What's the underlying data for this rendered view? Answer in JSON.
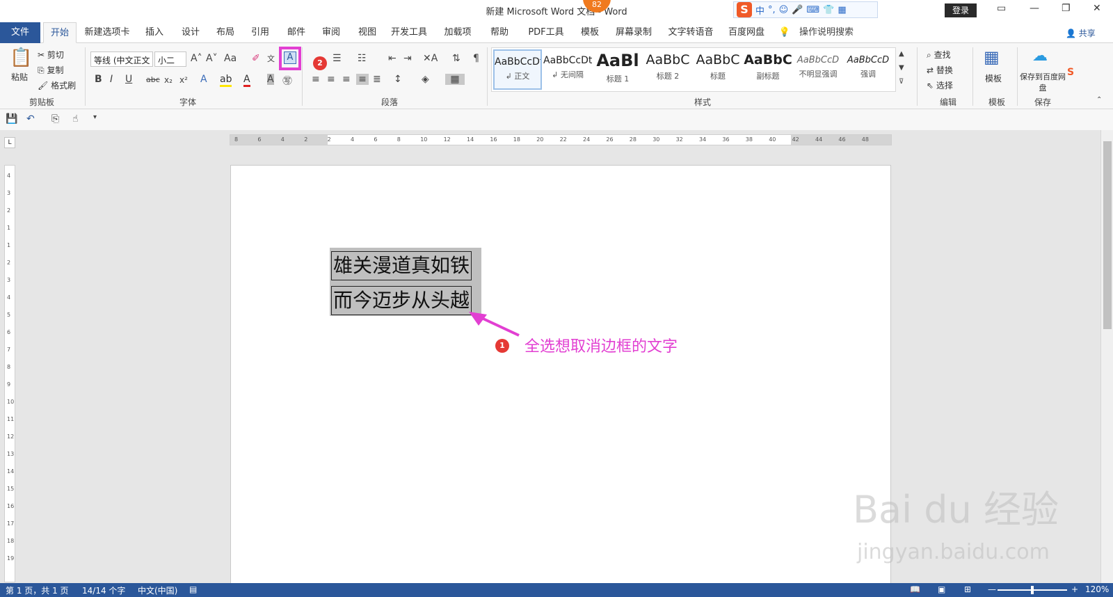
{
  "window": {
    "title": "新建 Microsoft Word 文档 - Word",
    "badge": "82",
    "login": "登录",
    "ime": {
      "logo": "S",
      "items": [
        "中",
        "°,",
        "☺",
        "🎤",
        "⌨",
        "👕",
        "▦"
      ]
    },
    "controls": {
      "ribbon_display": "▭",
      "minimize": "—",
      "restore": "❐",
      "close": "✕"
    }
  },
  "tabs": {
    "file": "文件",
    "items": [
      "开始",
      "新建选项卡",
      "插入",
      "设计",
      "布局",
      "引用",
      "邮件",
      "审阅",
      "视图",
      "开发工具",
      "加载项",
      "帮助",
      "PDF工具",
      "模板",
      "屏幕录制",
      "文字转语音",
      "百度网盘"
    ],
    "active": "开始",
    "search_hint": "操作说明搜索",
    "share": "共享"
  },
  "ribbon": {
    "clipboard": {
      "paste": "粘贴",
      "cut": "剪切",
      "copy": "复制",
      "format_painter": "格式刷",
      "label": "剪贴板"
    },
    "font": {
      "font_name": "等线 (中文正文",
      "font_size": "小二",
      "label": "字体",
      "bold": "B",
      "italic": "I",
      "underline": "U",
      "strike": "abc",
      "sub": "x₂",
      "sup": "x²",
      "grow": "A˄",
      "shrink": "A˅",
      "case": "Aa",
      "char_border": "A"
    },
    "paragraph": {
      "label": "段落"
    },
    "styles": {
      "label": "样式",
      "items": [
        {
          "preview": "AaBbCcDt",
          "name": "↲ 正文"
        },
        {
          "preview": "AaBbCcDt",
          "name": "↲ 无间隔"
        },
        {
          "preview": "AaBl",
          "name": "标题 1"
        },
        {
          "preview": "AaBbC",
          "name": "标题 2"
        },
        {
          "preview": "AaBbC",
          "name": "标题"
        },
        {
          "preview": "AaBbC",
          "name": "副标题"
        },
        {
          "preview": "AaBbCcD",
          "name": "不明显强调"
        },
        {
          "preview": "AaBbCcD",
          "name": "强调"
        }
      ]
    },
    "editing": {
      "find": "查找",
      "replace": "替换",
      "select": "选择",
      "label": "编辑"
    },
    "template": {
      "button": "模板",
      "label": "模板"
    },
    "save": {
      "button": "保存到百度网盘",
      "label": "保存"
    }
  },
  "ruler": {
    "h_ticks": [
      "8",
      "6",
      "4",
      "2",
      "2",
      "4",
      "6",
      "8",
      "10",
      "12",
      "14",
      "16",
      "18",
      "20",
      "22",
      "24",
      "26",
      "28",
      "30",
      "32",
      "34",
      "36",
      "38",
      "40",
      "42",
      "44",
      "46",
      "48"
    ],
    "v_ticks": [
      "4",
      "3",
      "2",
      "1",
      "1",
      "2",
      "3",
      "4",
      "5",
      "6",
      "7",
      "8",
      "9",
      "10",
      "11",
      "12",
      "13",
      "14",
      "15",
      "16",
      "17",
      "18",
      "19"
    ]
  },
  "document": {
    "lines": [
      "雄关漫道真如铁",
      "而今迈步从头越"
    ]
  },
  "annotations": {
    "step1_number": "1",
    "step1_text": "全选想取消边框的文字",
    "step2_number": "2",
    "highlight_color": "#e23fd2",
    "marker_color": "#e53935"
  },
  "status": {
    "page": "第 1 页，共 1 页",
    "words": "14/14 个字",
    "language": "中文(中国)",
    "zoom": "120%",
    "zoom_out": "—",
    "zoom_in": "+"
  },
  "watermark": {
    "logo": "Bai du 经验",
    "url": "jingyan.baidu.com"
  },
  "colors": {
    "accent": "#2b579a",
    "ribbon_bg": "#f7f7f7"
  }
}
